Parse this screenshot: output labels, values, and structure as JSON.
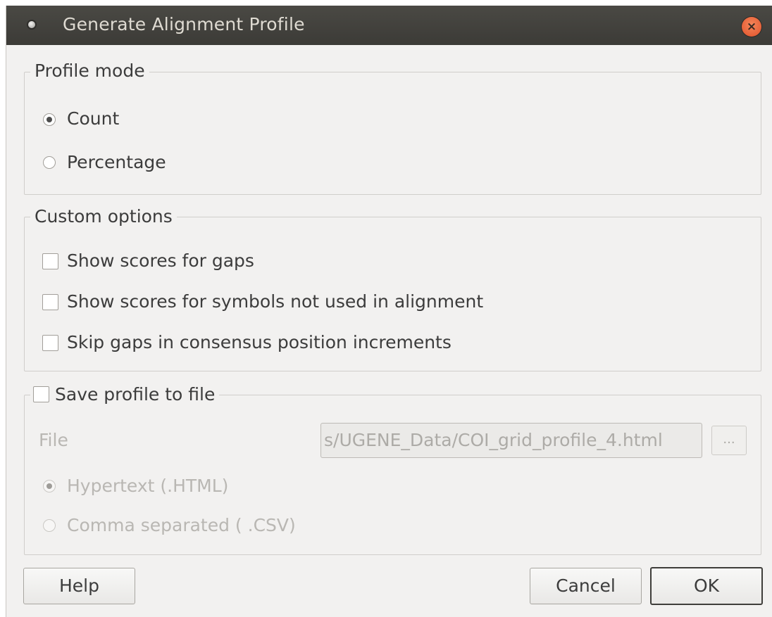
{
  "window": {
    "title": "Generate Alignment Profile",
    "close_icon": "×"
  },
  "profile_mode": {
    "legend": "Profile mode",
    "options": [
      {
        "label": "Count",
        "checked": true
      },
      {
        "label": "Percentage",
        "checked": false
      }
    ]
  },
  "custom_options": {
    "legend": "Custom options",
    "checkboxes": [
      {
        "label": "Show scores for gaps",
        "checked": false
      },
      {
        "label": "Show scores for symbols not used in alignment",
        "checked": false
      },
      {
        "label": "Skip gaps in consensus position increments",
        "checked": false
      }
    ]
  },
  "save_profile": {
    "legend": "Save profile to file",
    "checked": false,
    "file_label": "File",
    "file_value": "s/UGENE_Data/COI_grid_profile_4.html",
    "browse_label": "...",
    "formats": [
      {
        "label": "Hypertext  (.HTML)",
        "checked": true
      },
      {
        "label": "Comma separated ( .CSV)",
        "checked": false
      }
    ]
  },
  "buttons": {
    "help": "Help",
    "cancel": "Cancel",
    "ok": "OK"
  }
}
